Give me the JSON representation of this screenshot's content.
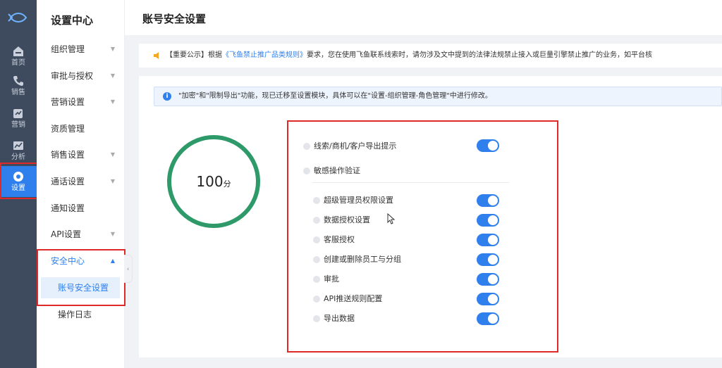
{
  "rail": {
    "items": [
      {
        "label": "首页",
        "icon": "home-icon"
      },
      {
        "label": "销售",
        "icon": "phone-icon"
      },
      {
        "label": "营销",
        "icon": "marketing-icon"
      },
      {
        "label": "分析",
        "icon": "chart-icon"
      },
      {
        "label": "设置",
        "icon": "gear-icon",
        "active": true
      }
    ]
  },
  "submenu": {
    "title": "设置中心",
    "items": [
      {
        "label": "组织管理"
      },
      {
        "label": "审批与授权"
      },
      {
        "label": "营销设置"
      },
      {
        "label": "资质管理"
      },
      {
        "label": "销售设置"
      },
      {
        "label": "通话设置"
      },
      {
        "label": "通知设置"
      },
      {
        "label": "API设置"
      },
      {
        "label": "安全中心"
      }
    ],
    "security_children": [
      {
        "label": "账号安全设置"
      },
      {
        "label": "操作日志"
      }
    ]
  },
  "header": {
    "title": "账号安全设置"
  },
  "notice": {
    "prefix": "【重要公示】根据",
    "link": "《飞鱼禁止推广品类规则》",
    "suffix": "要求，您在使用飞鱼联系线索时，请勿涉及文中提到的法律法规禁止接入或巨量引擎禁止推广的业务，如平台核"
  },
  "info": {
    "text": "\"加密\"和\"限制导出\"功能，现已迁移至设置模块，具体可以在\"设置-组织管理-角色管理\"中进行修改。"
  },
  "score": {
    "value": "100",
    "unit": "分"
  },
  "options": {
    "top": [
      {
        "label": "线索/商机/客户导出提示",
        "on": true
      },
      {
        "label": "敏感操作验证"
      }
    ],
    "sub": [
      {
        "label": "超级管理员权限设置",
        "on": true
      },
      {
        "label": "数据授权设置",
        "on": true
      },
      {
        "label": "客服授权",
        "on": true
      },
      {
        "label": "创建或删除员工与分组",
        "on": true
      },
      {
        "label": "审批",
        "on": true
      },
      {
        "label": "API推送规则配置",
        "on": true
      },
      {
        "label": "导出数据",
        "on": true
      }
    ]
  },
  "colors": {
    "primary": "#2f80ed",
    "score_ring": "#2e9a6a",
    "highlight": "#e02a2a",
    "rail": "#3e4b5e"
  }
}
